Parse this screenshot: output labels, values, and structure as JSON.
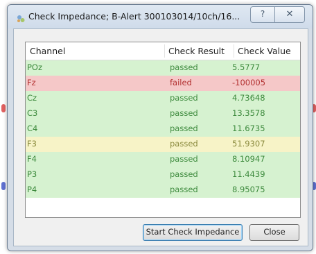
{
  "window": {
    "title": "Check Impedance; B-Alert 300103014/10ch/16...",
    "help_glyph": "?",
    "close_glyph": "✕"
  },
  "table": {
    "headers": [
      "Channel",
      "Check Result",
      "Check Value"
    ],
    "rows": [
      {
        "channel": "POz",
        "result": "passed",
        "value": "5.5777",
        "status": "green"
      },
      {
        "channel": "Fz",
        "result": "failed",
        "value": "-100005",
        "status": "red"
      },
      {
        "channel": "Cz",
        "result": "passed",
        "value": "4.73648",
        "status": "green"
      },
      {
        "channel": "C3",
        "result": "passed",
        "value": "13.3578",
        "status": "green"
      },
      {
        "channel": "C4",
        "result": "passed",
        "value": "11.6735",
        "status": "green"
      },
      {
        "channel": "F3",
        "result": "passed",
        "value": "51.9307",
        "status": "yellow"
      },
      {
        "channel": "F4",
        "result": "passed",
        "value": "8.10947",
        "status": "green"
      },
      {
        "channel": "P3",
        "result": "passed",
        "value": "11.4439",
        "status": "green"
      },
      {
        "channel": "P4",
        "result": "passed",
        "value": "8.95075",
        "status": "green"
      }
    ]
  },
  "buttons": {
    "start": "Start Check Impedance",
    "close": "Close"
  },
  "colors": {
    "green_bg": "#d6f2d0",
    "green_text": "#3d8a3d",
    "red_bg": "#f5c8c8",
    "red_text": "#b23030",
    "yellow_bg": "#f7f3c7",
    "yellow_text": "#8a8a3d"
  }
}
